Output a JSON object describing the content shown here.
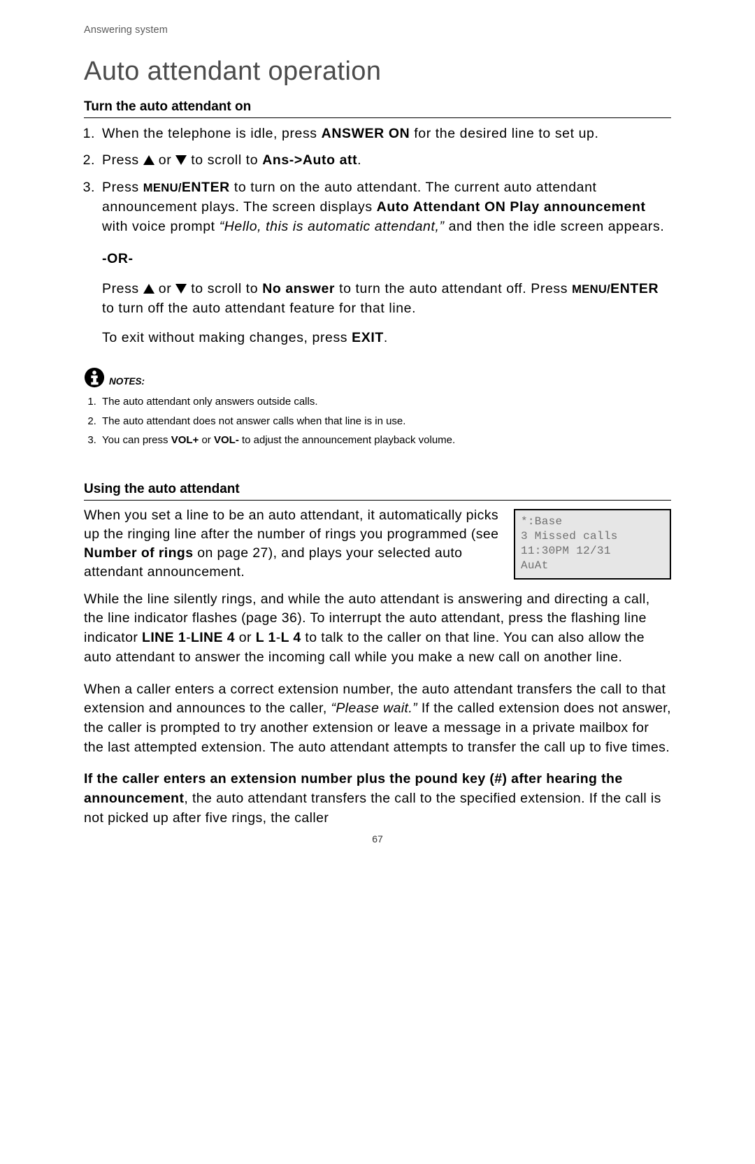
{
  "breadcrumb": "Answering system",
  "page_title": "Auto attendant operation",
  "section1": {
    "title": "Turn the auto attendant on",
    "step1_a": "When the telephone is idle, press ",
    "step1_key": "ANSWER ON",
    "step1_b": " for the desired line to set up.",
    "step2_a": "Press ",
    "step2_b": " or ",
    "step2_c": " to scroll to ",
    "step2_key": "Ans->Auto att",
    "step2_d": ".",
    "step3_a": "Press ",
    "step3_key1_small": "MENU/",
    "step3_key1_big": "ENTER",
    "step3_b": " to turn on the auto attendant. The current auto attendant announcement plays. The screen displays ",
    "step3_strong": "Auto Attendant ON Play announcement",
    "step3_c": " with voice prompt ",
    "step3_quote": "“Hello, this is automatic attendant,”",
    "step3_d": " and then the idle screen appears.",
    "or_label": "-OR-",
    "or1_a": "Press ",
    "or1_b": " or ",
    "or1_c": " to scroll to ",
    "or1_strong": "No answer",
    "or1_d": " to turn the auto attendant off. Press ",
    "or1_key_small": "MENU/",
    "or1_key_big": "ENTER",
    "or1_e": " to turn off the auto attendant feature for that line.",
    "exit_a": "To exit without making changes, press ",
    "exit_key": "EXIT",
    "exit_b": "."
  },
  "notes": {
    "label": "NOTES:",
    "n1": "The auto attendant only answers outside calls.",
    "n2": "The auto attendant does not answer calls when that line is in use.",
    "n3_a": "You can press ",
    "n3_k1": "VOL+",
    "n3_b": " or ",
    "n3_k2": "VOL-",
    "n3_c": " to adjust the announcement playback volume."
  },
  "section2": {
    "title": "Using the auto attendant",
    "intro_a": "When you set a line to be an auto attendant, it automatically picks up the ringing line after the number of rings you programmed (see ",
    "intro_strong": "Number of rings",
    "intro_b": " on page 27), and plays your selected auto attendant announcement.",
    "lcd": {
      "l1": "*:Base",
      "l2": "3 Missed calls",
      "l3": "11:30PM 12/31",
      "l4": "AuAt"
    },
    "p2_a": "While the line silently rings, and while the auto attendant is answering and directing a call, the line indicator flashes (page 36). To interrupt the auto attendant, press the flashing line indicator ",
    "p2_k1": "LINE 1",
    "p2_dash1": "-",
    "p2_k2": "LINE 4",
    "p2_b": " or ",
    "p2_k3": "L 1",
    "p2_dash2": "-",
    "p2_k4": "L 4",
    "p2_c": " to talk to the caller on that line. You can also allow the auto attendant to answer the incoming call while you make a new call on another line.",
    "p3_a": "When a caller enters a correct extension number, the auto attendant transfers the call to that extension and announces to the caller, ",
    "p3_quote": "“Please wait.”",
    "p3_b": " If the called extension does not answer, the caller is prompted to try another extension or leave a message in a private mailbox for the last attempted extension. The auto attendant attempts to transfer the call up to five times.",
    "p4_strong": "If the caller enters an extension number plus the pound key (#) after hearing the announcement",
    "p4_a": ", the auto attendant transfers the call to the specified extension. If the call is not picked up after five rings, the caller"
  },
  "page_number": "67"
}
